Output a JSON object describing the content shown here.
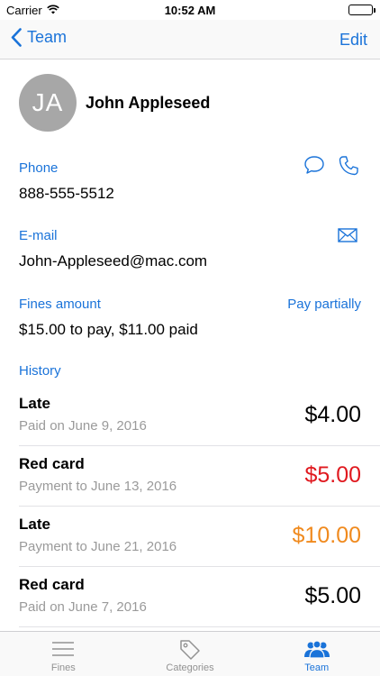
{
  "status_bar": {
    "carrier": "Carrier",
    "time": "10:52 AM"
  },
  "nav": {
    "back_label": "Team",
    "edit_label": "Edit"
  },
  "profile": {
    "initials": "JA",
    "name": "John Appleseed"
  },
  "phone": {
    "label": "Phone",
    "value": "888-555-5512"
  },
  "email": {
    "label": "E-mail",
    "value": "John-Appleseed@mac.com"
  },
  "fines": {
    "label": "Fines amount",
    "value": "$15.00 to pay, $11.00 paid",
    "action_label": "Pay partially"
  },
  "history": {
    "label": "History",
    "items": [
      {
        "title": "Late",
        "subtitle": "Paid on June 9, 2016",
        "amount": "$4.00",
        "color": "#000000"
      },
      {
        "title": "Red card",
        "subtitle": "Payment to June 13, 2016",
        "amount": "$5.00",
        "color": "#e0191f"
      },
      {
        "title": "Late",
        "subtitle": "Payment to June 21, 2016",
        "amount": "$10.00",
        "color": "#f08a1e"
      },
      {
        "title": "Red card",
        "subtitle": "Paid on June 7, 2016",
        "amount": "$5.00",
        "color": "#000000"
      }
    ]
  },
  "tabs": [
    {
      "label": "Fines",
      "icon": "list-icon",
      "active": false
    },
    {
      "label": "Categories",
      "icon": "tag-icon",
      "active": false
    },
    {
      "label": "Team",
      "icon": "team-icon",
      "active": true
    }
  ],
  "colors": {
    "accent": "#1a73d9",
    "muted": "#9a9a9a",
    "red": "#e0191f",
    "orange": "#f08a1e"
  }
}
